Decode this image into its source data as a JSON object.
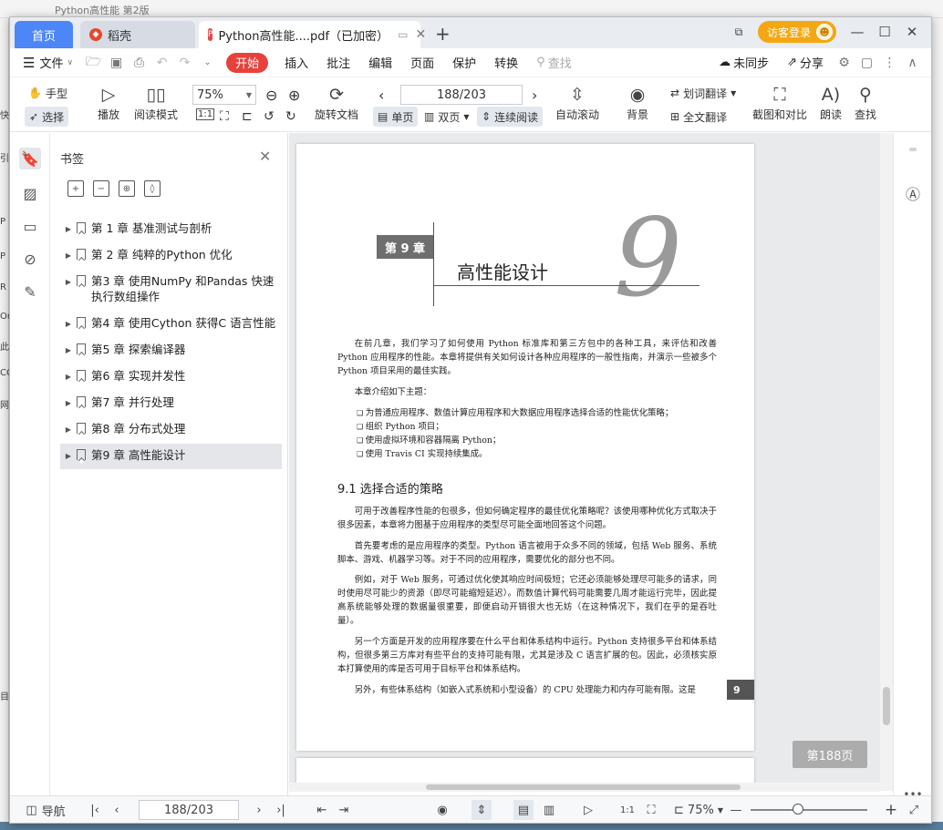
{
  "backdrop": {
    "title": "Python高性能 第2版",
    "left_chars": [
      "快",
      "引",
      "P",
      "P",
      "R",
      "Or",
      "此",
      "CC",
      "网",
      "目"
    ]
  },
  "tabs": {
    "home": "首页",
    "docer": "稻壳",
    "pdf": "Python高性能....pdf（已加密）",
    "new": "+"
  },
  "titlebar": {
    "guest_login": "访客登录"
  },
  "menu": {
    "file": "文件",
    "start": "开始",
    "insert": "插入",
    "annotate": "批注",
    "edit": "编辑",
    "page": "页面",
    "protect": "保护",
    "convert": "转换",
    "search": "查找",
    "unsync": "未同步",
    "share": "分享"
  },
  "ribbon": {
    "hand": "手型",
    "select": "选择",
    "play": "播放",
    "reading_mode": "阅读模式",
    "zoom": "75%",
    "rotate": "旋转文档",
    "page_input": "188/203",
    "single": "单页",
    "double": "双页",
    "continuous": "连续阅读",
    "autoscroll": "自动滚动",
    "background": "背景",
    "word_translate": "划词翻译",
    "full_translate": "全文翻译",
    "screenshot_compare": "截图和对比",
    "read_aloud": "朗读",
    "find": "查找"
  },
  "bookmarks": {
    "title": "书签",
    "items": [
      {
        "label": "第 1 章 基准测试与剖析"
      },
      {
        "label": "第 2 章 纯粹的Python 优化"
      },
      {
        "label": "第3 章 使用NumPy 和Pandas 快速执行数组操作"
      },
      {
        "label": "第4 章 使用Cython 获得C 语言性能"
      },
      {
        "label": "第5 章 探索编译器"
      },
      {
        "label": "第6 章 实现并发性"
      },
      {
        "label": "第7 章 并行处理"
      },
      {
        "label": "第8 章 分布式处理"
      },
      {
        "label": "第9 章 高性能设计"
      }
    ]
  },
  "document": {
    "chapter_badge": "第 9 章",
    "chapter_title": "高性能设计",
    "chapter_number": "9",
    "intro": "在前几章，我们学习了如何使用 Python 标准库和第三方包中的各种工具，来评估和改善 Python 应用程序的性能。本章将提供有关如何设计各种应用程序的一般性指南，并演示一些被多个 Python 项目采用的最佳实践。",
    "topics_intro": "本章介绍如下主题：",
    "bullets": [
      "为普通应用程序、数值计算应用程序和大数据应用程序选择合适的性能优化策略；",
      "组织 Python 项目；",
      "使用虚拟环境和容器隔离 Python；",
      "使用 Travis CI 实现持续集成。"
    ],
    "section_title": "9.1   选择合适的策略",
    "paragraphs": [
      "可用于改善程序性能的包很多，但如何确定程序的最佳优化策略呢？该使用哪种优化方式取决于很多因素，本章将力图基于应用程序的类型尽可能全面地回答这个问题。",
      "首先要考虑的是应用程序的类型。Python 语言被用于众多不同的领域，包括 Web 服务、系统脚本、游戏、机器学习等。对于不同的应用程序，需要优化的部分也不同。",
      "例如，对于 Web 服务，可通过优化使其响应时间极短；它还必须能够处理尽可能多的请求，同时使用尽可能少的资源（即尽可能缩短延迟）。而数值计算代码可能需要几周才能运行完毕，因此提高系统能够处理的数据量很重要，即便启动开销很大也无妨（在这种情况下，我们在乎的是吞吐量）。",
      "另一个方面是开发的应用程序要在什么平台和体系结构中运行。Python 支持很多平台和体系结构，但很多第三方库对有些平台的支持可能有限，尤其是涉及 C 语言扩展的包。因此，必须核实原本打算使用的库是否可用于目标平台和体系结构。",
      "另外，有些体系结构（如嵌入式系统和小型设备）的 CPU 处理能力和内存可能有限。这是"
    ],
    "page_tab": "9",
    "goto_page": "第188页"
  },
  "status": {
    "nav": "导航",
    "page_input": "188/203",
    "zoom": "75%"
  }
}
